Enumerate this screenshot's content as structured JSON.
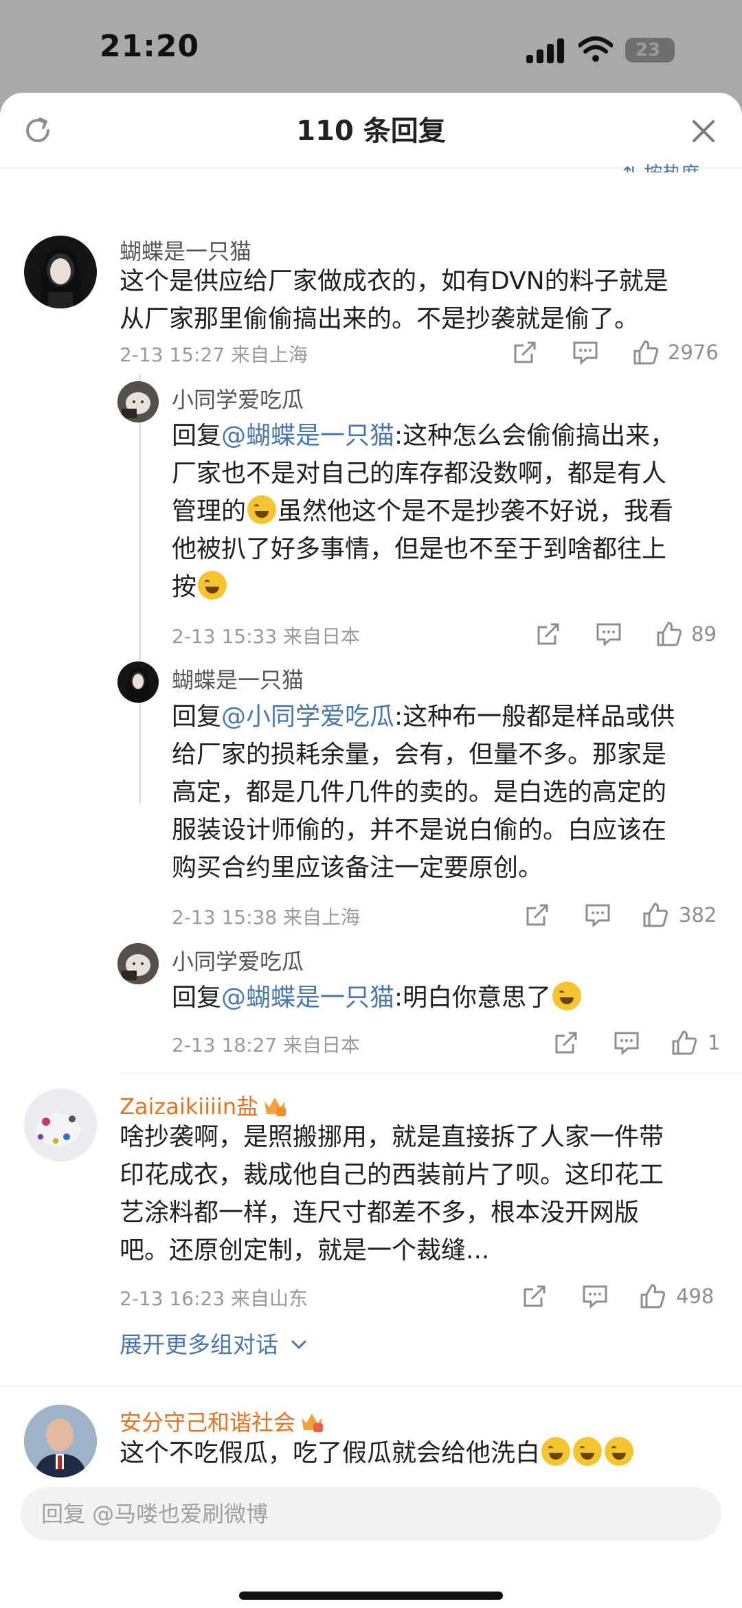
{
  "status": {
    "time": "21:20",
    "battery": "23"
  },
  "header": {
    "title": "110 条回复",
    "sort_label": "按热度",
    "sort_icon": "sort-arrows-icon"
  },
  "comments": [
    {
      "name": "蝴蝶是一只猫",
      "lines": [
        "这个是供应给厂家做成衣的，如有DVN的料子就是",
        "从厂家那里偷偷搞出来的。不是抄袭就是偷了。"
      ],
      "meta": "2-13 15:27  来自上海",
      "likes": "2976"
    }
  ],
  "replies": [
    {
      "name": "小同学爱吃瓜",
      "reply_prefix": "回复",
      "mention": "@蝴蝶是一只猫",
      "line1": ":这种怎么会偷偷搞出来，",
      "line2": "厂家也不是对自己的库存都没数啊，都是有人",
      "line3a": "管理的",
      "line3b": "虽然他这个是不是抄袭不好说，我看",
      "line4": "他被扒了好多事情，但是也不至于到啥都往上",
      "line5": "按",
      "meta": "2-13 15:33  来自日本",
      "likes": "89"
    },
    {
      "name": "蝴蝶是一只猫",
      "reply_prefix": "回复",
      "mention": "@小同学爱吃瓜",
      "line1": ":这种布一般都是样品或供",
      "line2": "给厂家的损耗余量，会有，但量不多。那家是",
      "line3": "高定，都是几件几件的卖的。是白选的高定的",
      "line4": "服装设计师偷的，并不是说白偷的。白应该在",
      "line5": "购买合约里应该备注一定要原创。",
      "meta": "2-13 15:38  来自上海",
      "likes": "382"
    },
    {
      "name": "小同学爱吃瓜",
      "reply_prefix": "回复",
      "mention": "@蝴蝶是一只猫",
      "line1": ":明白你意思了",
      "meta": "2-13 18:27  来自日本",
      "likes": "1"
    }
  ],
  "comment2": {
    "name": "Zaizaikiiiin盐",
    "lines": [
      "啥抄袭啊，是照搬挪用，就是直接拆了人家一件带",
      "印花成衣，裁成他自己的西装前片了呗。这印花工",
      "艺涂料都一样，连尺寸都差不多，根本没开网版",
      "吧。还原创定制，就是一个裁缝..."
    ],
    "meta": "2-13 16:23  来自山东",
    "likes": "498",
    "expand_label": "展开更多组对话"
  },
  "comment3": {
    "name": "安分守己和谐社会",
    "text": "这个不吃假瓜，吃了假瓜就会给他洗白"
  },
  "input": {
    "placeholder": "回复 @马喽也爱刷微博"
  },
  "colors": {
    "accent": "#4a77b0",
    "vip_name": "#e8721f"
  }
}
